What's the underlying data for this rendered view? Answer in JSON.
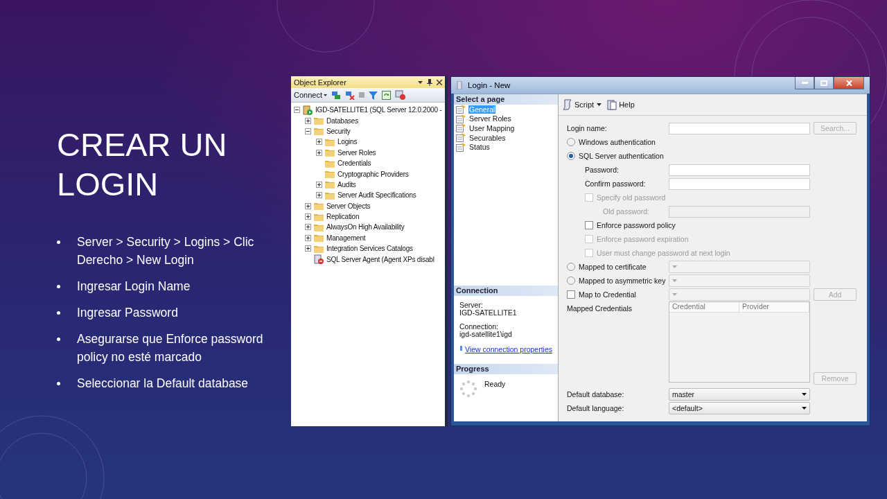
{
  "slide": {
    "title": "CREAR UN LOGIN",
    "bullets": [
      "Server > Security > Logins > Clic Derecho > New Login",
      "Ingresar Login Name",
      "Ingresar Password",
      "Asegurarse que Enforce password policy no esté marcado",
      "Seleccionar la Default database"
    ]
  },
  "object_explorer": {
    "title": "Object Explorer",
    "connect": "Connect",
    "tree": [
      {
        "kind": "server",
        "label": "IGD-SATELLITE1 (SQL Server 12.0.2000 -",
        "expanded": true,
        "children": [
          {
            "kind": "folder",
            "label": "Databases",
            "expanded": false
          },
          {
            "kind": "folder",
            "label": "Security",
            "expanded": true,
            "children": [
              {
                "kind": "folder",
                "label": "Logins",
                "expanded": false
              },
              {
                "kind": "folder",
                "label": "Server Roles",
                "expanded": false
              },
              {
                "kind": "folder",
                "label": "Credentials"
              },
              {
                "kind": "folder",
                "label": "Cryptographic Providers"
              },
              {
                "kind": "folder",
                "label": "Audits",
                "expanded": false
              },
              {
                "kind": "folder",
                "label": "Server Audit Specifications",
                "expanded": false
              }
            ]
          },
          {
            "kind": "folder",
            "label": "Server Objects",
            "expanded": false
          },
          {
            "kind": "folder",
            "label": "Replication",
            "expanded": false
          },
          {
            "kind": "folder",
            "label": "AlwaysOn High Availability",
            "expanded": false
          },
          {
            "kind": "folder",
            "label": "Management",
            "expanded": false
          },
          {
            "kind": "folder",
            "label": "Integration Services Catalogs",
            "expanded": false
          },
          {
            "kind": "agent",
            "label": "SQL Server Agent (Agent XPs disabl"
          }
        ]
      }
    ]
  },
  "login_window": {
    "title": "Login - New",
    "select_page": {
      "header": "Select a page",
      "pages": [
        {
          "label": "General",
          "selected": true
        },
        {
          "label": "Server Roles",
          "selected": false
        },
        {
          "label": "User Mapping",
          "selected": false
        },
        {
          "label": "Securables",
          "selected": false
        },
        {
          "label": "Status",
          "selected": false
        }
      ]
    },
    "connection": {
      "header": "Connection",
      "server_label": "Server:",
      "server": "IGD-SATELLITE1",
      "connection_label": "Connection:",
      "connection": "igd-satellite1\\igd",
      "link": "View connection properties"
    },
    "progress": {
      "header": "Progress",
      "status": "Ready"
    },
    "toolbar": {
      "script": "Script",
      "help": "Help"
    },
    "form": [
      {
        "kind": "field",
        "label": "Login name:",
        "button": {
          "label": "Search...",
          "disabled": true
        }
      },
      {
        "kind": "radio",
        "label": "Windows authentication",
        "selected": false
      },
      {
        "kind": "radio",
        "label": "SQL Server authentication",
        "selected": true,
        "children": [
          {
            "kind": "field",
            "label": "Password:"
          },
          {
            "kind": "field",
            "label": "Confirm password:"
          },
          {
            "kind": "checkbox",
            "label": "Specify old password",
            "checked": false,
            "disabled": true,
            "children": [
              {
                "kind": "field",
                "label": "Old password:",
                "disabled": true
              }
            ]
          },
          {
            "kind": "checkbox",
            "label": "Enforce password policy",
            "checked": false,
            "disabled": false
          },
          {
            "kind": "checkbox",
            "label": "Enforce password expiration",
            "checked": false,
            "disabled": true
          },
          {
            "kind": "checkbox",
            "label": "User must change password at next login",
            "checked": false,
            "disabled": true
          }
        ]
      },
      {
        "kind": "radio_combo",
        "label": "Mapped to certificate",
        "selected": false
      },
      {
        "kind": "radio_combo",
        "label": "Mapped to asymmetric key",
        "selected": false
      },
      {
        "kind": "checkbox_combo",
        "label": "Map to Credential",
        "checked": false,
        "button": {
          "label": "Add",
          "disabled": true
        }
      },
      {
        "kind": "grid",
        "label": "Mapped Credentials",
        "columns": [
          "Credential",
          "Provider"
        ],
        "button": {
          "label": "Remove",
          "disabled": true
        }
      },
      {
        "kind": "combo",
        "label": "Default database:",
        "value": "master"
      },
      {
        "kind": "combo",
        "label": "Default language:",
        "value": "<default>"
      }
    ]
  }
}
